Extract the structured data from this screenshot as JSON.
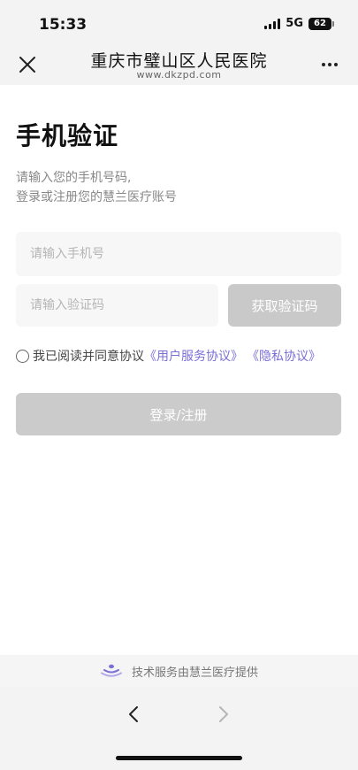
{
  "status_bar": {
    "time": "15:33",
    "network": "5G",
    "battery": "62"
  },
  "nav": {
    "title": "重庆市璧山区人民医院",
    "subtitle": "www.dkzpd.com",
    "close_icon": "close-icon",
    "more_icon": "more-icon"
  },
  "page": {
    "title": "手机验证",
    "desc_line1": "请输入您的手机号码,",
    "desc_line2": "登录或注册您的慧兰医疗账号"
  },
  "form": {
    "phone_placeholder": "请输入手机号",
    "code_placeholder": "请输入验证码",
    "get_code_label": "获取验证码",
    "agree_text": "我已阅读并同意协议",
    "user_agreement": "《用户服务协议》",
    "privacy_agreement": "《隐私协议》",
    "submit_label": "登录/注册",
    "agreed": false
  },
  "footer": {
    "provider_text": "技术服务由慧兰医疗提供",
    "logo_icon": "huilan-logo-icon"
  },
  "browser": {
    "back_icon": "chevron-left-icon",
    "forward_icon": "chevron-right-icon"
  },
  "colors": {
    "link": "#7a6fd6",
    "disabled_button": "#cbcbcb",
    "input_bg": "#f7f7f7",
    "bar_bg": "#f3f3f3"
  }
}
